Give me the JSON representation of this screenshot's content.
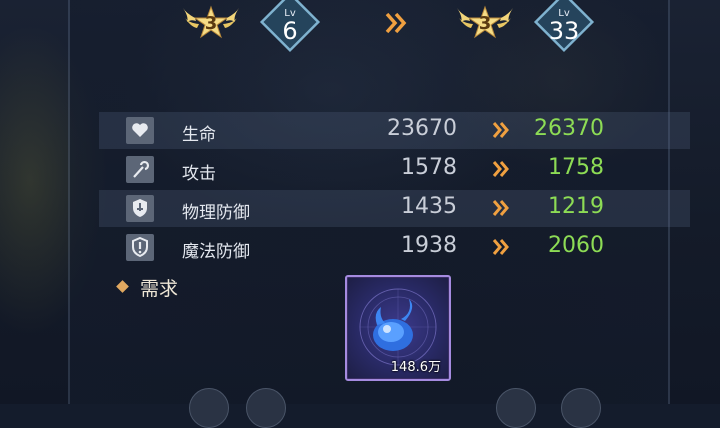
{
  "upgrade": {
    "current": {
      "stars": "3",
      "level_label": "Lv",
      "level": "6"
    },
    "next": {
      "stars": "3",
      "level_label": "Lv",
      "level": "33"
    }
  },
  "stats": [
    {
      "icon": "heart-icon",
      "name": "生命",
      "old": "23670",
      "new": "26370"
    },
    {
      "icon": "staff-icon",
      "name": "攻击",
      "old": "1578",
      "new": "1758"
    },
    {
      "icon": "shield-sword-icon",
      "name": "物理防御",
      "old": "1435",
      "new": "1219"
    },
    {
      "icon": "shield-exclaim-icon",
      "name": "魔法防御",
      "old": "1938",
      "new": "2060"
    }
  ],
  "requirement": {
    "label": "需求",
    "item": {
      "icon": "blue-spirit-orb-icon",
      "quantity": "148.6万"
    }
  },
  "colors": {
    "increase": "#8ddc55",
    "arrow": "#f0a040",
    "item_border": "#a58be0",
    "star_gold": "#f2d57a"
  }
}
